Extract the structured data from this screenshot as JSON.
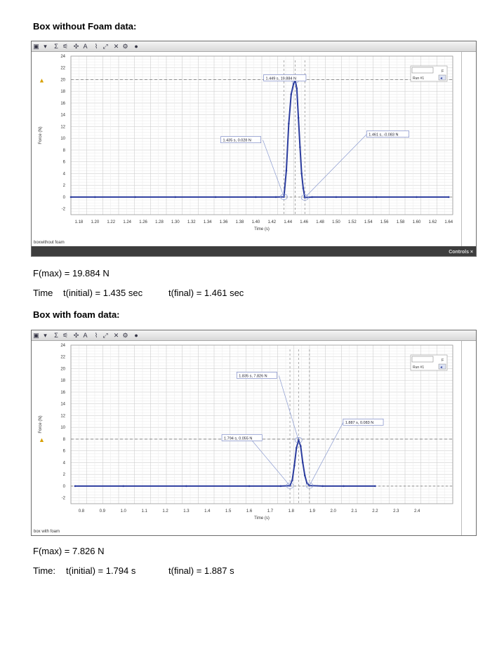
{
  "section1": {
    "heading": "Box without Foam data:",
    "fmax": "F(max) = 19.884 N",
    "time_label": "Time",
    "t_initial": "t(initial) = 1.435 sec",
    "t_final": "t(final) = 1.461 sec",
    "dataset_name": "boxwithout foam",
    "controls_label": "Controls ×",
    "run_label": "Run #1",
    "f_label": "F",
    "chart_data": {
      "type": "line",
      "ylabel": "Force (N)",
      "xlabel": "Time (s)",
      "xlim": [
        1.17,
        1.645
      ],
      "ylim": [
        -3,
        24
      ],
      "x_ticks": [
        "1.18",
        "1.20",
        "1.22",
        "1.24",
        "1.26",
        "1.28",
        "1.30",
        "1.32",
        "1.34",
        "1.36",
        "1.38",
        "1.40",
        "1.42",
        "1.44",
        "1.46",
        "1.48",
        "1.50",
        "1.52",
        "1.54",
        "1.56",
        "1.58",
        "1.60",
        "1.62",
        "1.64"
      ],
      "y_ticks": [
        "24",
        "22",
        "20",
        "18",
        "16",
        "14",
        "12",
        "10",
        "8",
        "6",
        "4",
        "2",
        "0",
        "-2"
      ],
      "series": [
        {
          "x": [
            1.17,
            1.2,
            1.25,
            1.3,
            1.35,
            1.4,
            1.425,
            1.435,
            1.438,
            1.441,
            1.444,
            1.447,
            1.449,
            1.451,
            1.453,
            1.455,
            1.457,
            1.459,
            1.461,
            1.47,
            1.5,
            1.55,
            1.6,
            1.64
          ],
          "y": [
            0,
            0,
            0,
            0,
            0,
            0,
            0,
            0.028,
            4.5,
            12.5,
            17.5,
            19.3,
            19.884,
            18.5,
            13.5,
            8.5,
            4.0,
            1.5,
            -0.083,
            0,
            0,
            0,
            0,
            0
          ]
        }
      ],
      "annotations": [
        {
          "text": "1.449 s, 19.884 N",
          "x": 1.449,
          "y": 19.884
        },
        {
          "text": "1.435 s, 0.028 N",
          "x": 1.435,
          "y": 0.028
        },
        {
          "text": "1.461 s, -0.083 N",
          "x": 1.461,
          "y": -0.083
        }
      ],
      "dashed_level": 20
    }
  },
  "section2": {
    "heading": "Box with foam data:",
    "fmax": "F(max) = 7.826 N",
    "time_label": "Time:",
    "t_initial": "t(initial) = 1.794 s",
    "t_final": "t(final) = 1.887 s",
    "dataset_name": "box with foam",
    "run_label": "Run #1",
    "f_label": "F",
    "chart_data": {
      "type": "line",
      "ylabel": "Force (N)",
      "xlabel": "Time (s)",
      "xlim": [
        0.75,
        2.57
      ],
      "ylim": [
        -3,
        24
      ],
      "x_ticks": [
        "0.8",
        "0.9",
        "1.0",
        "1.1",
        "1.2",
        "1.3",
        "1.4",
        "1.5",
        "1.6",
        "1.7",
        "1.8",
        "1.9",
        "2.0",
        "2.1",
        "2.2",
        "2.3",
        "2.4"
      ],
      "y_ticks": [
        "24",
        "22",
        "20",
        "18",
        "16",
        "14",
        "12",
        "10",
        "8",
        "6",
        "4",
        "2",
        "0",
        "-2"
      ],
      "series": [
        {
          "x": [
            0.77,
            1.0,
            1.3,
            1.6,
            1.75,
            1.794,
            1.805,
            1.815,
            1.825,
            1.835,
            1.845,
            1.855,
            1.865,
            1.875,
            1.887,
            1.95,
            2.05,
            2.2
          ],
          "y": [
            0,
            0,
            0,
            0,
            0,
            0.055,
            1.0,
            3.5,
            6.5,
            7.826,
            6.8,
            4.0,
            1.8,
            0.5,
            0.083,
            0,
            0,
            0
          ]
        }
      ],
      "annotations": [
        {
          "text": "1.835 s, 7.826 N",
          "x": 1.835,
          "y": 7.826
        },
        {
          "text": "1.794 s, 0.055 N",
          "x": 1.794,
          "y": 0.055
        },
        {
          "text": "1.887 s, 0.083 N",
          "x": 1.887,
          "y": 0.083
        }
      ],
      "dashed_level": 8
    }
  }
}
